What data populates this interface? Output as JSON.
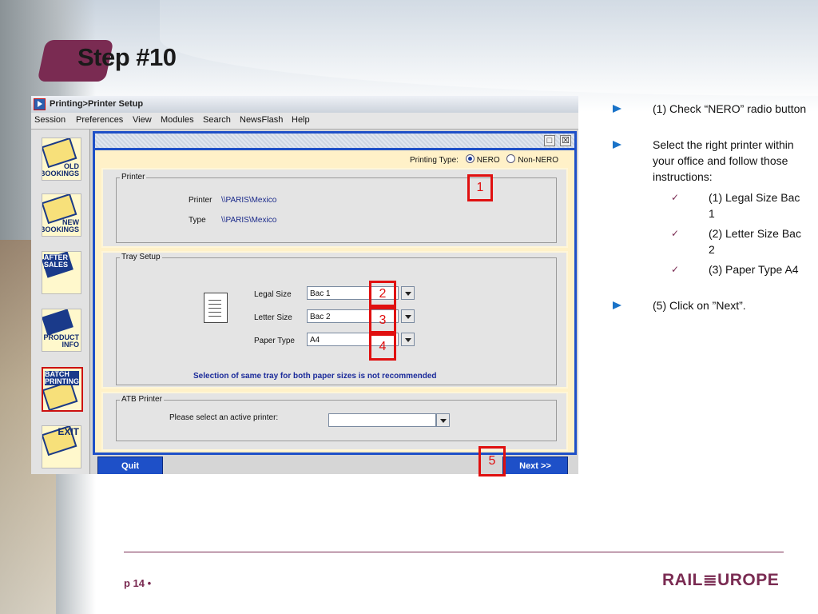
{
  "slide": {
    "title": "Step #10",
    "page_number": "p 14 •",
    "brand": "RAIL≣UROPE"
  },
  "app": {
    "window_title": "Printing>Printer Setup",
    "menu": [
      {
        "label": "Session"
      },
      {
        "label": "Preferences"
      },
      {
        "label": "View"
      },
      {
        "label": "Modules"
      },
      {
        "label": "Search"
      },
      {
        "label": "NewsFlash"
      },
      {
        "label": "Help"
      }
    ],
    "sidebar": [
      {
        "label": "OLD\nBOOKINGS",
        "icon": "old-bookings-icon"
      },
      {
        "label": "NEW\nBOOKINGS",
        "icon": "new-bookings-icon"
      },
      {
        "label": "AFTER\nSALES",
        "icon": "after-sales-icon"
      },
      {
        "label": "PRODUCT\nINFO",
        "icon": "product-info-icon"
      },
      {
        "label": "BATCH\nPRINTING",
        "icon": "batch-printing-icon"
      },
      {
        "label": "EXIT",
        "icon": "exit-icon"
      }
    ],
    "printing_type": {
      "label": "Printing Type:",
      "options": [
        "NERO",
        "Non-NERO"
      ],
      "selected": "NERO"
    },
    "printer_group": {
      "legend": "Printer",
      "printer_label": "Printer",
      "printer_value": "\\\\PARIS\\Mexico",
      "type_label": "Type",
      "type_value": "\\\\PARIS\\Mexico"
    },
    "tray_group": {
      "legend": "Tray Setup",
      "legal_label": "Legal Size",
      "legal_value": "Bac 1",
      "letter_label": "Letter Size",
      "letter_value": "Bac 2",
      "paper_label": "Paper Type",
      "paper_value": "A4",
      "warning": "Selection of same tray for both paper sizes is not recommended"
    },
    "atb_group": {
      "legend": "ATB Printer",
      "prompt": "Please select an active printer:",
      "value": ""
    },
    "buttons": {
      "quit": "Quit",
      "next": "Next >>"
    },
    "window_controls": {
      "restore": "□",
      "close": "☒"
    }
  },
  "annotations": [
    "1",
    "2",
    "3",
    "4",
    "5"
  ],
  "instructions": {
    "items": [
      {
        "text": "(1) Check “NERO” radio button",
        "level": 1
      },
      {
        "text": "Select the right printer within your office and follow those instructions:",
        "level": 1
      },
      {
        "text": "(1) Legal Size Bac 1",
        "level": 2
      },
      {
        "text": "(2) Letter Size Bac 2",
        "level": 2
      },
      {
        "text": "(3) Paper Type A4",
        "level": 2
      },
      {
        "text": "(5) Click on ”Next”.",
        "level": 1
      }
    ]
  },
  "colors": {
    "accent": "#7a2b52",
    "app_blue": "#1e50c8",
    "panel": "#fff1c8",
    "highlight": "#e01010",
    "bullet": "#1a73c8"
  }
}
